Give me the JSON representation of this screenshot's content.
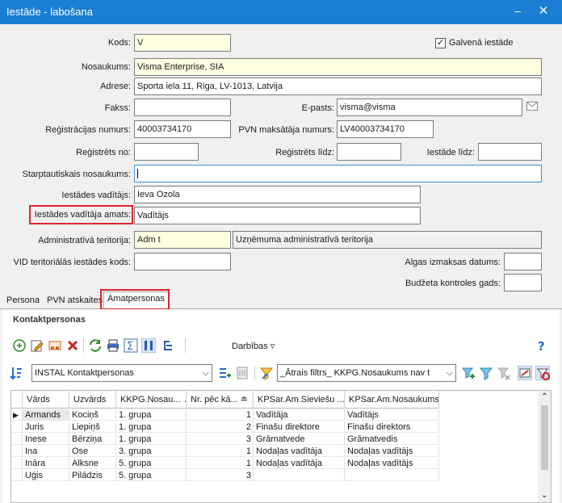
{
  "window": {
    "title": "Iestāde - labošana",
    "minimize": "–",
    "close": "✕"
  },
  "form": {
    "kods": {
      "label": "Kods:",
      "value": "V"
    },
    "galvena": {
      "label": "Galvenā iestāde",
      "checked": "✓"
    },
    "nosaukums": {
      "label": "Nosaukums:",
      "value": "Visma Enterprise, SIA"
    },
    "adrese": {
      "label": "Adrese:",
      "value": "Sporta iela 11, Riga, LV-1013, Latvija"
    },
    "fakss": {
      "label": "Fakss:",
      "value": ""
    },
    "epasts": {
      "label": "E-pasts:",
      "value": "visma@visma"
    },
    "regnr": {
      "label": "Reģistrācijas numurs:",
      "value": "40003734170"
    },
    "pvn": {
      "label": "PVN maksātāja numurs:",
      "value": "LV40003734170"
    },
    "regno": {
      "label": "Reģistrēts no:",
      "value": ""
    },
    "reglidz": {
      "label": "Reģistrēts līdz:",
      "value": ""
    },
    "iestlidz": {
      "label": "Iestāde līdz:",
      "value": ""
    },
    "starpt": {
      "label": "Starptautiskais nosaukums:",
      "value": ""
    },
    "vaditajs": {
      "label": "Iestādes vadītājs:",
      "value": "Ieva Ozola"
    },
    "amats": {
      "label": "Iestādes vadītāja amats:",
      "value": "Vadītājs"
    },
    "admter": {
      "label": "Administratīvā teritorija:",
      "code": "Adm t",
      "name": "Uzņēmuma administratīvā teritorija"
    },
    "vid": {
      "label": "VID teritoriālās iestādes kods:",
      "value": ""
    },
    "algas": {
      "label": "Algas izmaksas datums:",
      "value": ""
    },
    "budzeta": {
      "label": "Budžeta kontroles gads:",
      "value": ""
    }
  },
  "tabs": [
    {
      "label": "Persona"
    },
    {
      "label": "PVN atskaites"
    },
    {
      "label": "Amatpersonas"
    }
  ],
  "panel": {
    "title": "Kontaktpersonas",
    "actions_label": "Darbības ▿",
    "view_select": "INSTAL Kontaktpersonas",
    "filter_select": "_Ātrais filtrs_ KKPG.Nosaukums nav t"
  },
  "grid": {
    "columns": [
      "Vārds",
      "Uzvārds",
      "KKPG.Nosau... ▲",
      "Nr. pēc kā... ≐",
      "KPSar.Am.Sieviešu ...",
      "KPSar.Am.Nosaukums"
    ],
    "rows": [
      [
        "Armands",
        "Kociņš",
        "1. grupa",
        "1",
        "Vadītāja",
        "Vadītājs"
      ],
      [
        "Juris",
        "Liepiņš",
        "1. grupa",
        "2",
        "Finašu direktore",
        "Finašu direktors"
      ],
      [
        "Inese",
        "Bērziņa",
        "1. grupa",
        "3",
        "Grāmatvede",
        "Grāmatvedis"
      ],
      [
        "Ina",
        "Ose",
        "3. grupa",
        "1",
        "Nodaļas vadītāja",
        "Nodaļas vadītājs"
      ],
      [
        "Ināra",
        "Alksne",
        "5. grupa",
        "1",
        "Nodaļas vadītāja",
        "Nodaļas vadītājs"
      ],
      [
        "Uģis",
        "Pilādzis",
        "5. grupa",
        "3",
        "",
        ""
      ]
    ],
    "row_pointer": "▶"
  },
  "colors": {
    "titlebar": "#1a7fd4",
    "highlight": "#e2242a",
    "required": "#ffffe1"
  }
}
